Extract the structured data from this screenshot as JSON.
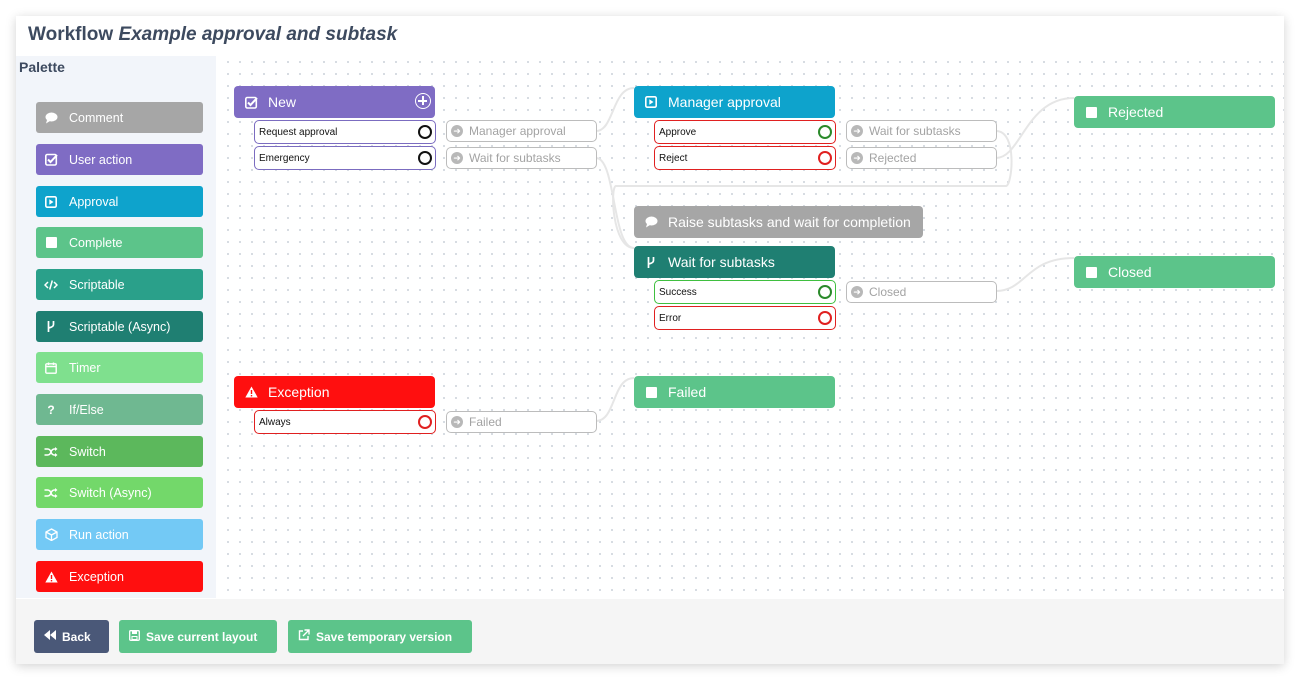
{
  "title": {
    "prefix": "Workflow",
    "name": "Example approval and subtask"
  },
  "palette": {
    "title": "Palette",
    "items": [
      {
        "label": "Comment",
        "icon": "comment-icon",
        "color": "#a6a6a6"
      },
      {
        "label": "User action",
        "icon": "checkbox-icon",
        "color": "#7f6cc4"
      },
      {
        "label": "Approval",
        "icon": "play-square-icon",
        "color": "#0ea3cc"
      },
      {
        "label": "Complete",
        "icon": "square-icon",
        "color": "#5cc48a"
      },
      {
        "label": "Scriptable",
        "icon": "code-icon",
        "color": "#2aa08a"
      },
      {
        "label": "Scriptable (Async)",
        "icon": "branch-icon",
        "color": "#1f7f72"
      },
      {
        "label": "Timer",
        "icon": "calendar-icon",
        "color": "#7fe08e"
      },
      {
        "label": "If/Else",
        "icon": "question-icon",
        "color": "#6fb891"
      },
      {
        "label": "Switch",
        "icon": "shuffle-icon",
        "color": "#5cb85c"
      },
      {
        "label": "Switch (Async)",
        "icon": "shuffle-icon",
        "color": "#73d86a"
      },
      {
        "label": "Run action",
        "icon": "cube-icon",
        "color": "#73c9f5"
      },
      {
        "label": "Exception",
        "icon": "warning-icon",
        "color": "#ff0f0f"
      }
    ]
  },
  "nodes": {
    "new": {
      "title": "New",
      "color": "#7f6cc4",
      "outputs": [
        {
          "label": "Request approval",
          "target": "Manager approval"
        },
        {
          "label": "Emergency",
          "target": "Wait for subtasks"
        }
      ]
    },
    "manager_approval": {
      "title": "Manager approval",
      "color": "#0ea3cc",
      "outputs": [
        {
          "label": "Approve",
          "target": "Wait for subtasks"
        },
        {
          "label": "Reject",
          "target": "Rejected"
        }
      ]
    },
    "rejected": {
      "title": "Rejected",
      "color": "#5cc48a"
    },
    "comment": {
      "title": "Raise subtasks and wait for completion",
      "color": "#a6a6a6"
    },
    "wait_for_subtasks": {
      "title": "Wait for subtasks",
      "color": "#1f7f72",
      "outputs": [
        {
          "label": "Success",
          "target": "Closed"
        },
        {
          "label": "Error",
          "target": ""
        }
      ]
    },
    "closed": {
      "title": "Closed",
      "color": "#5cc48a"
    },
    "exception": {
      "title": "Exception",
      "color": "#ff0f0f",
      "outputs": [
        {
          "label": "Always",
          "target": "Failed"
        }
      ]
    },
    "failed": {
      "title": "Failed",
      "color": "#5cc48a"
    }
  },
  "footer": {
    "back": {
      "label": "Back",
      "color": "#4a5878"
    },
    "save_layout": {
      "label": "Save current layout",
      "color": "#5cc48a"
    },
    "save_temp": {
      "label": "Save temporary version",
      "color": "#5cc48a"
    }
  }
}
